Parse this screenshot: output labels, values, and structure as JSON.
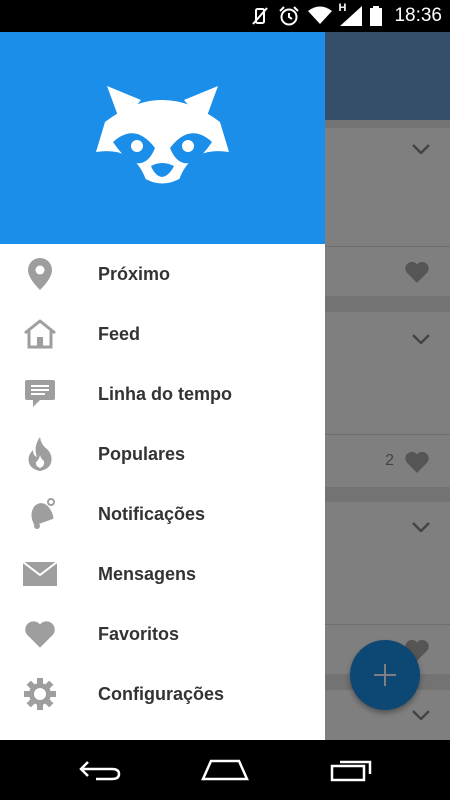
{
  "status_bar": {
    "time": "18:36",
    "network_letter": "H",
    "icons": [
      "vibrate-off-icon",
      "alarm-icon",
      "wifi-icon",
      "signal-icon",
      "battery-icon"
    ]
  },
  "colors": {
    "accent": "#1a8ee8",
    "icon_gray": "#9e9e9e",
    "text": "#333333"
  },
  "drawer": {
    "logo_icon": "raccoon-logo",
    "items": [
      {
        "label": "Próximo",
        "icon": "location-pin-icon"
      },
      {
        "label": "Feed",
        "icon": "home-icon"
      },
      {
        "label": "Linha do tempo",
        "icon": "chat-bubble-icon"
      },
      {
        "label": "Populares",
        "icon": "flame-icon"
      },
      {
        "label": "Notificações",
        "icon": "bell-icon"
      },
      {
        "label": "Mensagens",
        "icon": "envelope-icon"
      },
      {
        "label": "Favoritos",
        "icon": "heart-icon"
      },
      {
        "label": "Configurações",
        "icon": "gear-icon"
      }
    ]
  },
  "background": {
    "like_count": "2",
    "fab_icon": "plus-icon"
  },
  "nav_bar": {
    "buttons": [
      "back-icon",
      "home-icon",
      "recents-icon"
    ]
  }
}
